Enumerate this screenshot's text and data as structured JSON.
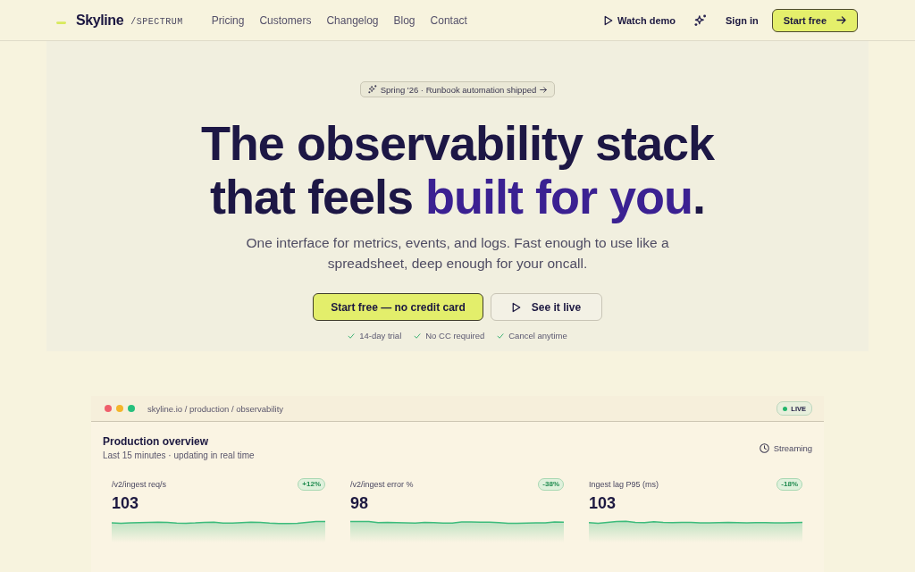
{
  "header": {
    "logo": {
      "name": "Skyline",
      "suffix": "/SPECTRUM"
    },
    "nav": [
      "Pricing",
      "Customers",
      "Changelog",
      "Blog",
      "Contact"
    ],
    "watch_demo": "Watch demo",
    "sign_in": "Sign in",
    "start_free": "Start free"
  },
  "hero": {
    "announcement": "Spring '26 · Runbook automation shipped",
    "heading": {
      "line_1": "The observability stack",
      "line_2": "that feels",
      "highlight": "built for you",
      "end": "."
    },
    "subtitle": "One interface for metrics, events, and logs. Fast enough to use like a spreadsheet, deep enough for your oncall.",
    "primary_cta": "Start free — no credit card",
    "secondary_cta": "See it live",
    "perks": [
      "14-day trial",
      "No CC required",
      "Cancel anytime"
    ]
  },
  "dashboard": {
    "window": {
      "path": "skyline.io / production / observability",
      "status": "LIVE"
    },
    "title": "Production overview",
    "subtitle": "Last 15 minutes · updating in real time",
    "streaming": "Streaming",
    "metrics": [
      {
        "label": "/v2/ingest req/s",
        "change": "+12%",
        "value": "103"
      },
      {
        "label": "/v2/ingest error %",
        "change": "-38%",
        "value": "98"
      },
      {
        "label": "Ingest lag P95 (ms)",
        "change": "-18%",
        "value": "103"
      }
    ]
  }
}
